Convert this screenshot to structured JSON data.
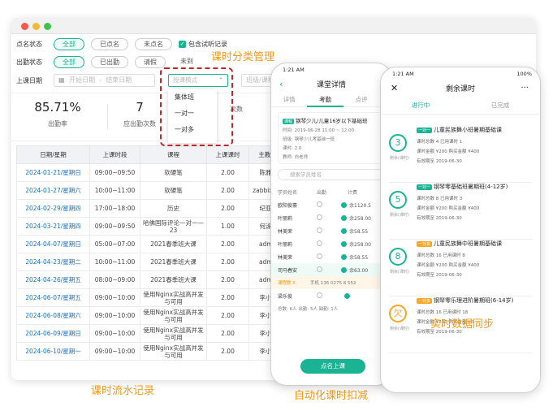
{
  "filters": {
    "attendance_label": "点名状态",
    "attendance_options": [
      "全部",
      "已点名",
      "未点名"
    ],
    "include_trial": "包含试听记录",
    "presence_label": "出勤状态",
    "presence_options": [
      "全部",
      "已出勤",
      "请假",
      "未到"
    ],
    "date_label": "上课日期",
    "start_placeholder": "开始日期",
    "end_placeholder": "结束日期",
    "mode_placeholder": "授课模式",
    "class_placeholder": "班级/课程"
  },
  "dropdown": {
    "items": [
      "集体班",
      "一对一",
      "一对多"
    ]
  },
  "stats": [
    {
      "value": "85.71%",
      "label": "出勤率"
    },
    {
      "value": "7",
      "label": "应出勤次数"
    },
    {
      "value": "",
      "label": "次数"
    }
  ],
  "table": {
    "headers": [
      "日期/星期",
      "上课时段",
      "课程",
      "上课课时",
      "主教/助教"
    ],
    "rows": [
      [
        "2024-01-21/星期日",
        "09:00~09:50",
        "软硬笔",
        "2.00",
        "陈雅玲、"
      ],
      [
        "2024-01-27/星期六",
        "10:00~11:00",
        "软硬笔",
        "2.00",
        "zabbixcesi、"
      ],
      [
        "2024-02-29/星期四",
        "17:00~18:00",
        "历史",
        "2.00",
        "纪亚玲、"
      ],
      [
        "2024-03-21/星期四",
        "09:00~09:50",
        "哈佛国际评论一对一—23",
        "1.00",
        "何泳辉、"
      ],
      [
        "2024-04-07/星期日",
        "05:00~07:00",
        "2021春季班大课",
        "2.00",
        "admin、"
      ],
      [
        "2024-04-23/星期二",
        "10:00~11:00",
        "2021春季班大课",
        "2.00",
        "admin、"
      ],
      [
        "2024-04-26/星期五",
        "08:00~09:00",
        "2021春季班大课",
        "2.00",
        "admin、"
      ],
      [
        "2024-06-07/星期五",
        "09:00~10:00",
        "使用Nginx实战高并发与可用",
        "2.00",
        "李小东、"
      ],
      [
        "2024-06-08/星期六",
        "09:00~10:00",
        "使用Nginx实战高并发与可用",
        "2.00",
        "李小东、"
      ],
      [
        "2024-06-09/星期日",
        "09:00~10:00",
        "使用Nginx实战高并发与可用",
        "2.00",
        "李小东、"
      ],
      [
        "2024-06-10/星期一",
        "09:00~10:00",
        "使用Nginx实战高并发与可用",
        "2.00",
        "李小东、"
      ]
    ]
  },
  "captions": {
    "category": "课时分类管理",
    "flow": "课时流水记录",
    "auto": "自动化课时扣减",
    "sync": "实时数据同步"
  },
  "phone1": {
    "time": "1:21 AM",
    "title": "课堂详情",
    "tabs": [
      "详情",
      "考勤",
      "点评"
    ],
    "course_tag": "课程",
    "course_name": "钢琴少儿/儿童16岁以下基础班",
    "course_time": "时间: 2019-06-28 11:00 ~ 12:00",
    "course_class": "班级: 钢琴少儿考基础一班",
    "course_hours": "课时: 2.0",
    "course_teacher": "教师: 白老师",
    "search": "搜索学员姓名",
    "col_name": "学员姓名",
    "col_present": "出勤",
    "col_fee": "计费",
    "students": [
      {
        "name": "欧阳俊豪",
        "fee": "余1120.5"
      },
      {
        "name": "叶丽莉",
        "fee": "余258.00"
      },
      {
        "name": "林美荣",
        "fee": "余58.55"
      },
      {
        "name": "叶丽莉",
        "fee": "余258.00"
      },
      {
        "name": "林美荣",
        "fee": "余58.55"
      },
      {
        "name": "司马春安",
        "fee": "余63.00"
      }
    ],
    "remaining_label": "课程数 5",
    "phone_label": "手机 136 0275 8 552",
    "last_name": "梁乐俊",
    "last_sub": "试听",
    "totals": "总数: 6人  出勤: 5人  缺勤: 1人",
    "button": "点名上课"
  },
  "phone2": {
    "time": "1:21 AM",
    "battery": "100%",
    "title": "剩余课时",
    "tabs": [
      "进行中",
      "已完成"
    ],
    "remain_label": "剩余(课时)",
    "items": [
      {
        "count": "3",
        "tag": "一对一",
        "title": "儿童民族舞小班暑期基础课",
        "l1": "课时总数 4  已用课时 1",
        "l2": "课时金额 ¥200  购买金额 ¥400",
        "l3": "有效期至 2019-06-30",
        "orange": false
      },
      {
        "count": "5",
        "tag": "一对一",
        "title": "钢琴零基础班暑期班(4-12岁)",
        "l1": "课时总数 8  已用课时 3",
        "l2": "课时金额 ¥200  购买金额 ¥400",
        "l3": "有效期至 2019-06-30",
        "orange": false
      },
      {
        "count": "8",
        "tag": "一对多",
        "title": "儿童民族舞中班暑期基础课",
        "l1": "课时总数 16  已用课时 8",
        "l2": "课时金额 ¥200  购买金额 ¥400",
        "l3": "有效期至 2019-06-30",
        "orange": false
      },
      {
        "count": "欠",
        "tag": "一对多",
        "title": "钢琴零乐理进阶暑期班(6-14岁)",
        "l1": "课时总数 16  已用课时 18",
        "l2": "课时金额 ¥200  购买金额 ¥0",
        "l3": "有效期至 2019-06-30",
        "orange": true
      }
    ]
  }
}
